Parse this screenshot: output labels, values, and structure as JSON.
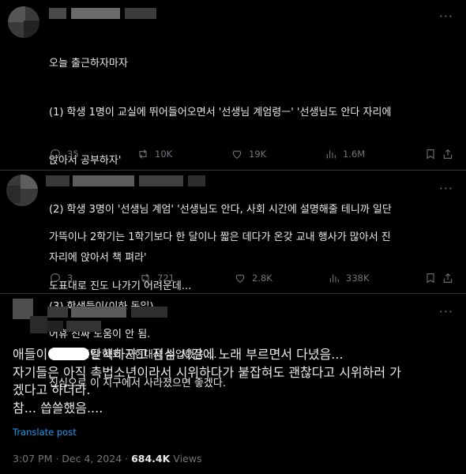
{
  "post1": {
    "lines": [
      "오늘 출근하자마자",
      "(1) 학생 1명이 교실에 뛰어들어오면서 '선생님 계엄령ㅡ' '선생님도 안다 자리에",
      "앉아서 공부하자'",
      "(2) 학생 3명이 '선생님 계엄' '선생님도 안다, 사회 시간에 설명해줄 테니까 일단",
      "자리에 앉아서 책 펴라'",
      "(3) 학생들이(이하 동일)",
      "오늘 온종일 사회 근현대사 수업했음...."
    ],
    "replies": "35",
    "reposts": "10K",
    "likes": "19K",
    "views": "1.6M"
  },
  "post2": {
    "lines": [
      "가뜩이나 2학기는 1학기보다 한 달이나 짧은 데다가 온갖 교내 행사가 많아서 진",
      "도표대로 진도 나가기 어려운데...",
      "어휴 진짜 도움이 안 됨.",
      "진심으로 이 지구에서 사라졌으면 좋겠다."
    ],
    "replies": "3",
    "reposts": "721",
    "likes": "2.8K",
    "views": "338K"
  },
  "post3": {
    "line1_pre": "애들이",
    "line1_post": "탄핵하자고 점심 시간에 노래 부르면서 다녔음...",
    "line2": "자기들은 아직 촉법소년이라서 시위하다가 붙잡혀도 괜찮다고 시위하러 가",
    "line3": "겠다고 하더라.",
    "line4": "참... 씁쓸했음....",
    "translate": "Translate post",
    "time": "3:07 PM · Dec 4, 2024 · ",
    "views_count": "684.4K",
    "views_label": " Views"
  },
  "colors": {
    "background": "#000000",
    "text": "#e7e9ea",
    "muted": "#71767b",
    "link": "#1d9bf0"
  },
  "icons": [
    "more-icon",
    "reply-icon",
    "repost-icon",
    "like-icon",
    "views-icon",
    "bookmark-icon",
    "share-icon"
  ]
}
